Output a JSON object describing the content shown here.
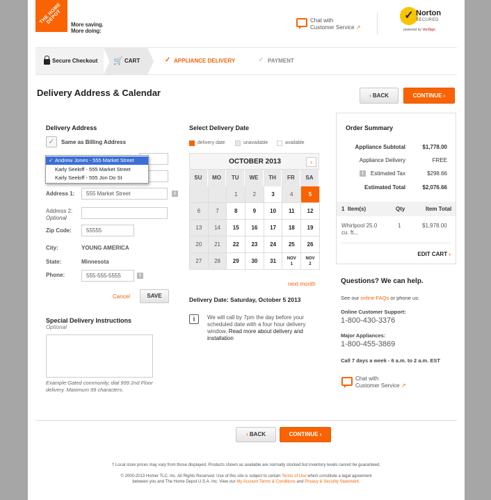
{
  "header": {
    "logo_text": "THE HOME DEPOT",
    "tagline_line1": "More saving.",
    "tagline_line2": "More doing:",
    "chat_line1": "Chat with",
    "chat_line2": "Customer Service",
    "norton_name": "Norton",
    "norton_secured": "SECURED",
    "norton_powered": "powered by",
    "norton_verisign": "VeriSign"
  },
  "steps": {
    "secure": "Secure Checkout",
    "cart": "CART",
    "delivery": "APPLIANCE DELIVERY",
    "payment": "PAYMENT"
  },
  "page_title": "Delivery Address & Calendar",
  "buttons": {
    "back": "BACK",
    "continue": "CONTINUE",
    "save": "SAVE",
    "cancel": "Cancel"
  },
  "address": {
    "title": "Delivery Address",
    "same_as_billing": "Same as Billing Address",
    "dropdown_options": [
      "Andrew Jones - 555 Market Street",
      "Karly Seeloff - 555 Market Street",
      "Karly Seeloff - 555 Jon Do St"
    ],
    "address1_label": "Address 1:",
    "address1_value": "555 Market Street",
    "address2_label": "Address 2:",
    "address2_optional": "Optional",
    "zip_label": "Zip Code:",
    "zip_value": "55555",
    "city_label": "City:",
    "city_value": "YOUNG AMERICA",
    "state_label": "State:",
    "state_value": "Minnesota",
    "phone_label": "Phone:",
    "phone_value": "555-555-5555"
  },
  "instructions": {
    "title": "Special Delivery Instructions",
    "optional": "Optional",
    "hint": "Example:Gated community, dial 999 2nd Floor delivery. Maximum 99 characters."
  },
  "calendar": {
    "title": "Select Delivery Date",
    "legend": [
      "delivery date",
      "unavailable",
      "available"
    ],
    "month": "OCTOBER 2013",
    "dow": [
      "SU",
      "MO",
      "TU",
      "WE",
      "TH",
      "FR",
      "SA"
    ],
    "cells": [
      {
        "t": "",
        "s": "empty"
      },
      {
        "t": "",
        "s": "empty"
      },
      {
        "t": "1",
        "s": "unav"
      },
      {
        "t": "2",
        "s": "unav"
      },
      {
        "t": "3",
        "s": "av"
      },
      {
        "t": "4",
        "s": "unav"
      },
      {
        "t": "5",
        "s": "sel"
      },
      {
        "t": "6",
        "s": "unav"
      },
      {
        "t": "7",
        "s": "unav"
      },
      {
        "t": "8",
        "s": "av"
      },
      {
        "t": "9",
        "s": "av"
      },
      {
        "t": "10",
        "s": "av"
      },
      {
        "t": "11",
        "s": "av"
      },
      {
        "t": "12",
        "s": "av"
      },
      {
        "t": "13",
        "s": "unav"
      },
      {
        "t": "14",
        "s": "unav"
      },
      {
        "t": "15",
        "s": "av"
      },
      {
        "t": "16",
        "s": "av"
      },
      {
        "t": "17",
        "s": "av"
      },
      {
        "t": "18",
        "s": "av"
      },
      {
        "t": "19",
        "s": "av"
      },
      {
        "t": "20",
        "s": "unav"
      },
      {
        "t": "21",
        "s": "unav"
      },
      {
        "t": "22",
        "s": "av"
      },
      {
        "t": "23",
        "s": "av"
      },
      {
        "t": "24",
        "s": "av"
      },
      {
        "t": "25",
        "s": "av"
      },
      {
        "t": "26",
        "s": "av"
      },
      {
        "t": "27",
        "s": "unav"
      },
      {
        "t": "28",
        "s": "unav"
      },
      {
        "t": "29",
        "s": "av"
      },
      {
        "t": "30",
        "s": "av"
      },
      {
        "t": "31",
        "s": "av"
      },
      {
        "t": "NOV\n1",
        "s": "nov"
      },
      {
        "t": "NOV\n2",
        "s": "nov"
      }
    ],
    "next_month": "next month",
    "delivery_date": "Delivery Date: Saturday, October 5 2013",
    "note_plain": "We will call by 7pm the day before your scheduled date with a four hour delivery window.",
    "note_link": "Read more about delivery and installation"
  },
  "summary": {
    "title": "Order Summary",
    "rows": [
      {
        "label": "Appliance Subtotal",
        "value": "$1,778.00",
        "bold": true
      },
      {
        "label": "Appliance Delivery",
        "value": "FREE",
        "bold": false
      },
      {
        "label": "Estimated Tax",
        "value": "$298.66",
        "bold": false
      },
      {
        "label": "Estimated Total",
        "value": "$2,076.66",
        "bold": true
      }
    ],
    "col_items": "1  Item(s)",
    "col_qty": "Qty",
    "col_total": "Item Total",
    "item_name": "Whirlpool 25.0 cu. ft...",
    "item_qty": "1",
    "item_total": "$1,978.00",
    "edit_cart": "EDIT CART"
  },
  "help": {
    "title": "Questions? We can help.",
    "see_our": "See our",
    "faqs": "online FAQs",
    "or_phone": "or phone us:",
    "online_label": "Online Customer Support:",
    "online_phone": "1-800-430-3376",
    "major_label": "Major Appliances:",
    "major_phone": "1-800-455-3869",
    "hours": "Call 7 days a week - 6 a.m. to 2 a.m. EST",
    "chat_line1": "Chat with",
    "chat_line2": "Customer Service"
  },
  "footer": {
    "line1": "† Local store prices may vary from those displayed. Products shown as available are normally stocked but inventory levels cannot be guaranteed.",
    "line2_a": "© 2000-2013 Homer TLC, Inc. All Rights Reserved. Use of this site is subject to certain",
    "terms": "Terms of Use",
    "line2_b": "which constitute a legal agreement",
    "line3_a": "between you and The Home Depot U.S.A. Inc. View our",
    "account_terms": "My Account Terms & Conditions",
    "and": "and",
    "privacy": "Privacy & Security Statement."
  },
  "colors": {
    "brand": "#f96302",
    "selected_option": "#3b6fd6"
  },
  "icons": [
    "lock-icon",
    "cart-icon",
    "check-icon",
    "tag-icon",
    "chat-icon",
    "info-icon",
    "checkbox-icon"
  ]
}
